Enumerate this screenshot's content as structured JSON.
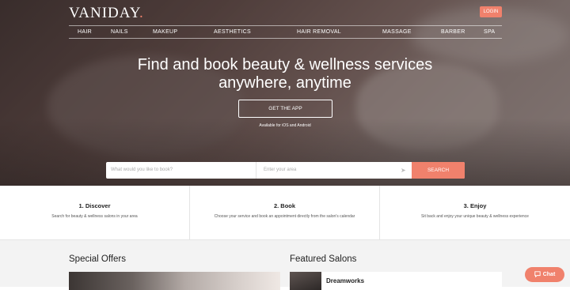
{
  "brand": {
    "name": "VANIDAY",
    "dot": ".",
    "accent": "#f0816c"
  },
  "header": {
    "login_label": "LOGIN"
  },
  "nav": {
    "items": [
      "HAIR",
      "NAILS",
      "MAKEUP",
      "AESTHETICS",
      "HAIR REMOVAL",
      "MASSAGE",
      "BARBER",
      "SPA"
    ]
  },
  "hero": {
    "headline_line1": "Find and book beauty & wellness services",
    "headline_line2": "anywhere, anytime",
    "cta_label": "GET THE APP",
    "availability": "Available for iOS and Android"
  },
  "search": {
    "query_placeholder": "What would you like to book?",
    "location_placeholder": "Enter your area",
    "location_icon": "location-arrow-icon",
    "button_label": "SEARCH"
  },
  "steps": [
    {
      "title": "1. Discover",
      "text": "Search for beauty & wellness salons in your area"
    },
    {
      "title": "2. Book",
      "text": "Choose your service and book an appointment directly from the salon's calendar"
    },
    {
      "title": "3. Enjoy",
      "text": "Sit back and enjoy your unique beauty & wellness experience"
    }
  ],
  "sections": {
    "special_offers": "Special Offers",
    "featured_salons": "Featured Salons",
    "featured_salon_name": "Dreamworks"
  },
  "chat": {
    "label": "Chat",
    "icon": "chat-bubble-icon"
  }
}
